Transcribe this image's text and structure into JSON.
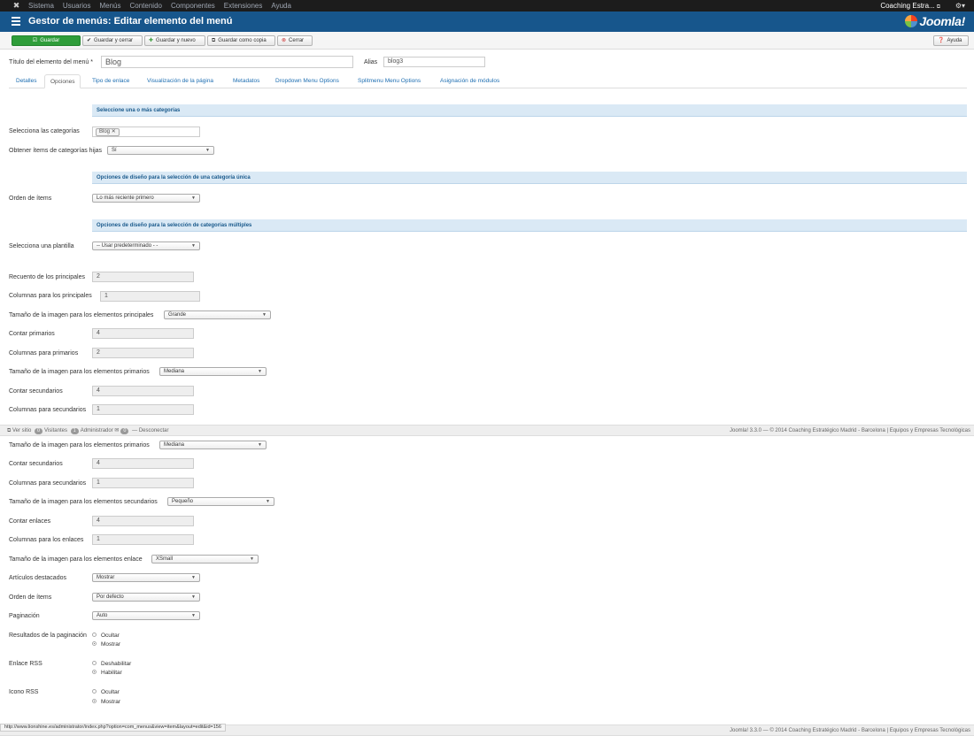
{
  "navbar": {
    "menu": [
      "Sistema",
      "Usuarios",
      "Menús",
      "Contenido",
      "Componentes",
      "Extensiones",
      "Ayuda"
    ],
    "site_name": "Coaching Estra..."
  },
  "header": {
    "title": "Gestor de menús: Editar elemento del menú",
    "brand": "Joomla!"
  },
  "toolbar": {
    "save": "Guardar",
    "save_close": "Guardar y cerrar",
    "save_new": "Guardar y nuevo",
    "save_copy": "Guardar como copia",
    "close": "Cerrar",
    "help": "Ayuda"
  },
  "form": {
    "title_label": "Título del elemento del menú *",
    "title_value": "Blog",
    "alias_label": "Alias",
    "alias_value": "blog3"
  },
  "tabs": [
    "Detalles",
    "Opciones",
    "Tipo de enlace",
    "Visualización de la página",
    "Metadatos",
    "Dropdown Menu Options",
    "Splitmenu Menu Options",
    "Asignación de módulos"
  ],
  "active_tab": "Opciones",
  "sections": {
    "categories": "Seleccione una o más categorías",
    "single": "Opciones de diseño para la selección de una categoría única",
    "multiple": "Opciones de diseño para la selección de categorías múltiples"
  },
  "fields": {
    "select_categories": "Selecciona las categorías",
    "category_tag": "Blog",
    "child_items": "Obtener ítems de categorías hijas",
    "child_items_value": "Sí",
    "item_order": "Orden de ítems",
    "item_order_value": "Lo más reciente primero",
    "template": "Selecciona una plantilla",
    "template_value": "-- Usar predeterminado - -",
    "leading_count": "Recuento de los principales",
    "leading_count_value": "2",
    "leading_cols": "Columnas para los principales",
    "leading_cols_value": "1",
    "leading_img": "Tamaño de la imagen para los elementos principales",
    "leading_img_value": "Grande",
    "intro_count": "Contar primarios",
    "intro_count_value": "4",
    "intro_cols": "Columnas para primarios",
    "intro_cols_value": "2",
    "intro_img": "Tamaño de la imagen para los elementos primarios",
    "intro_img_value": "Mediana",
    "secondary_count": "Contar secundarios",
    "secondary_count_value": "4",
    "secondary_cols": "Columnas para secundarios",
    "secondary_cols_value": "1"
  },
  "statusbar": {
    "view_site": "Ver sitio",
    "visitors_count": "0",
    "visitors": "Visitantes",
    "admins_count": "1",
    "admins": "Administrador",
    "messages_count": "0",
    "logout": "Desconectar",
    "footer": "Joomla! 3.3.0  —  © 2014 Coaching Estratégico Madrid - Barcelona | Equipos y Empresas Tecnológicas"
  },
  "fields2": {
    "intro_img": "Tamaño de la imagen para los elementos primarios",
    "intro_img_value": "Mediana",
    "secondary_count": "Contar secundarios",
    "secondary_count_value": "4",
    "secondary_cols": "Columnas para secundarios",
    "secondary_cols_value": "1",
    "secondary_img": "Tamaño de la imagen para los elementos secundarios",
    "secondary_img_value": "Pequeño",
    "links_count": "Contar enlaces",
    "links_count_value": "4",
    "links_cols": "Columnas para los enlaces",
    "links_cols_value": "1",
    "links_img": "Tamaño de la imagen para los elementos enlace",
    "links_img_value": "XSmall",
    "featured": "Artículos destacados",
    "featured_value": "Mostrar",
    "item_order": "Orden de ítems",
    "item_order_value": "Por defecto",
    "pagination": "Paginación",
    "pagination_value": "Auto",
    "pagination_results": "Resultados de la paginación",
    "rss_link": "Enlace RSS",
    "rss_icon": "Icono RSS",
    "hide": "Ocultar",
    "show": "Mostrar",
    "disable": "Deshabilitar",
    "enable": "Habilitar"
  },
  "url_status": "http://www.lionshine.es/administrator/index.php?option=com_menus&view=item&layout=edit&id=156"
}
